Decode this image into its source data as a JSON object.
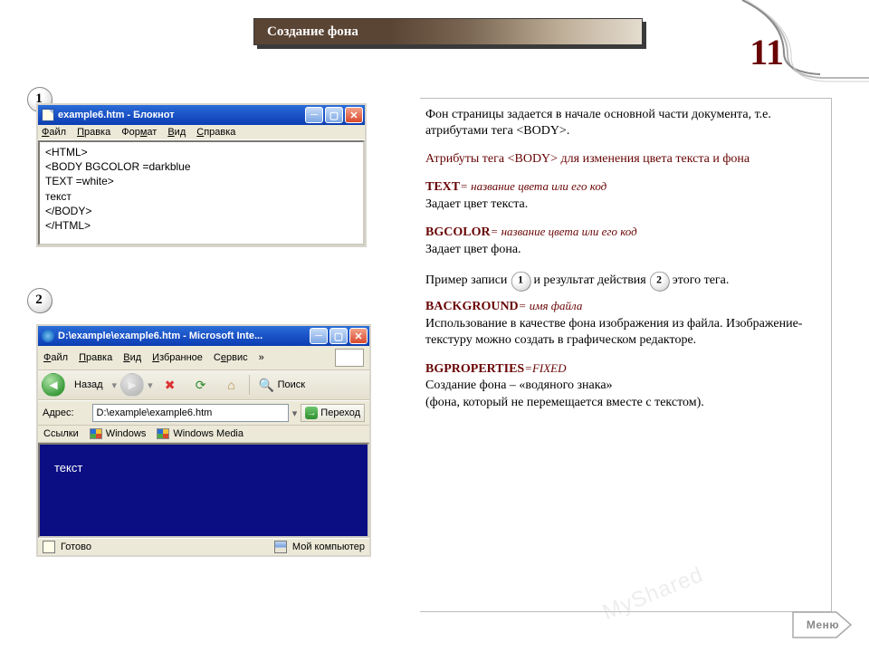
{
  "title": "Создание фона",
  "page_number": "11",
  "badges": {
    "left1": "1",
    "left2": "2",
    "inline1": "1",
    "inline2": "2"
  },
  "notepad": {
    "title": "example6.htm - Блокнот",
    "menu": [
      "Файл",
      "Правка",
      "Формат",
      "Вид",
      "Справка"
    ],
    "content": "<HTML>\n<BODY BGCOLOR =darkblue\nTEXT =white>\nтекст\n</BODY>\n</HTML>"
  },
  "ie": {
    "title": "D:\\example\\example6.htm - Microsoft Inte...",
    "menu": [
      "Файл",
      "Правка",
      "Вид",
      "Избранное",
      "Сервис"
    ],
    "back_label": "Назад",
    "search_label": "Поиск",
    "addr_label": "Адрес:",
    "addr_value": "D:\\example\\example6.htm",
    "go_label": "Переход",
    "links_label": "Ссылки",
    "links": [
      "Windows",
      "Windows Media"
    ],
    "page_text": "текст",
    "status_left": "Готово",
    "status_right": "Мой компьютер"
  },
  "rcol": {
    "intro1": "Фон страницы задается в начале основной части документа, т.е. атрибутами тега <BODY>.",
    "attrs_heading": "Атрибуты тега <BODY> для изменения цвета текста и фона",
    "text_attr": "TEXT",
    "text_attr_val": "= название цвета      или его код",
    "text_attr_desc": "Задает цвет текста.",
    "bgcolor_attr": "BGCOLOR",
    "bgcolor_attr_val": "= название цвета или его код",
    "bgcolor_attr_desc": "Задает цвет фона.",
    "example_before": "Пример записи",
    "example_mid": "и результат действия",
    "example_after": "этого тега.",
    "background_attr": "BACKGROUND",
    "background_attr_val": "= имя файла",
    "background_attr_desc": "Использование в качестве фона изображения из файла. Изображение-текстуру можно создать в графическом редакторе.",
    "bgprops_attr": "BGPROPERTIES",
    "bgprops_attr_val": "=FIXED",
    "bgprops_desc1": "Создание фона – «водяного знака»",
    "bgprops_desc2": "(фона, который не перемещается вместе с текстом)."
  },
  "watermark": "MyShared",
  "menu_button": "Меню"
}
